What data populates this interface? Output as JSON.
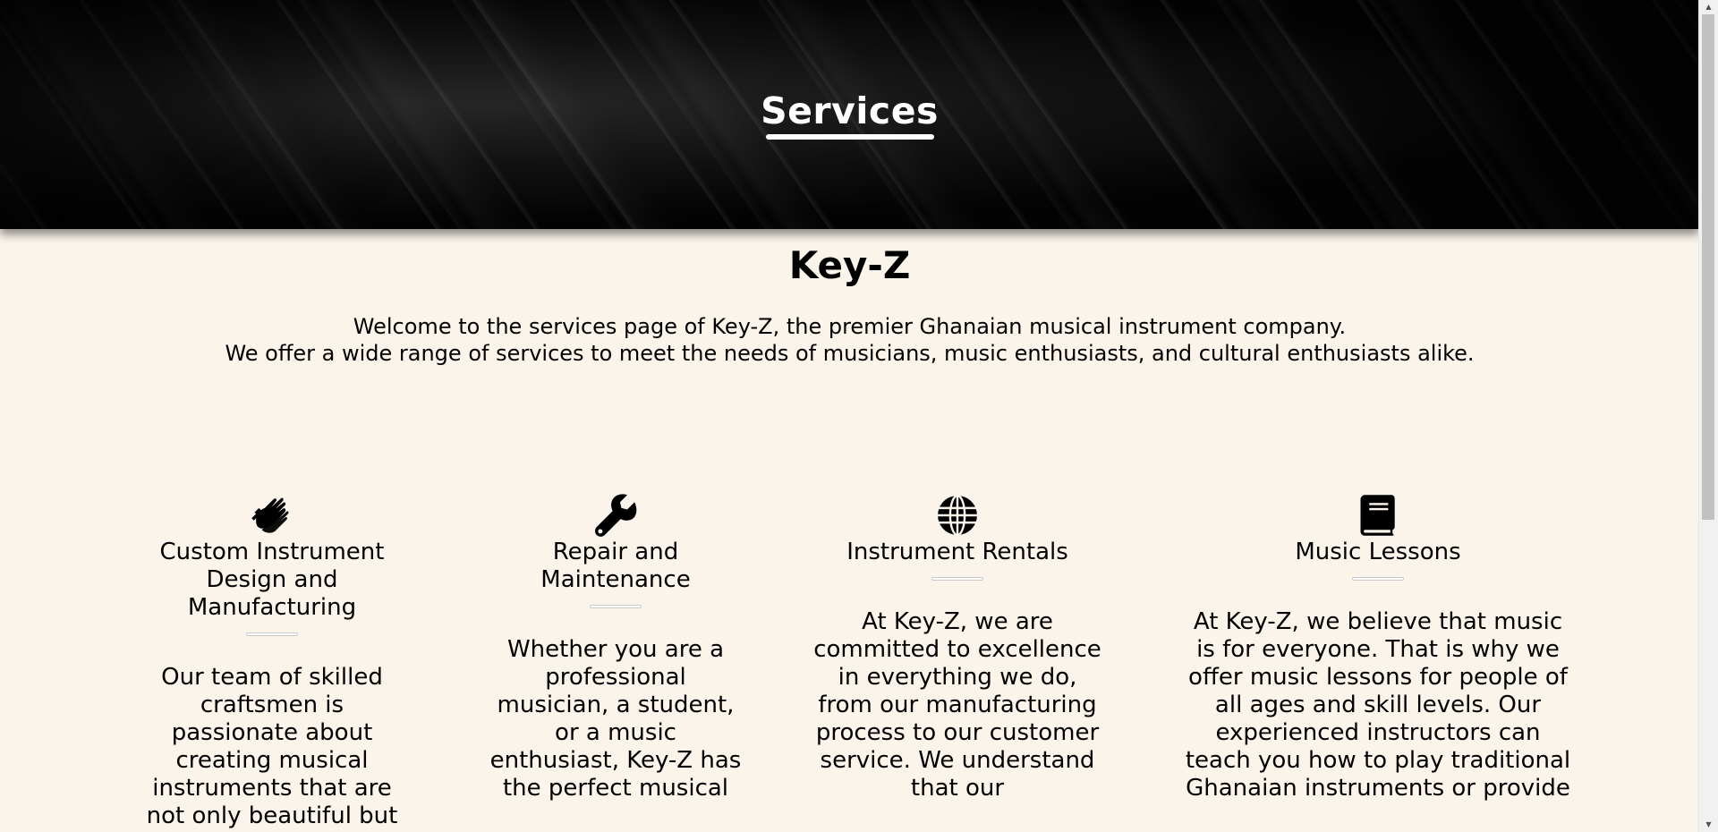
{
  "hero": {
    "title": "Services"
  },
  "brand": "Key-Z",
  "intro": {
    "line1": "Welcome to the services page of Key-Z, the premier Ghanaian musical instrument company.",
    "line2": "We offer a wide range of services to meet the needs of musicians, music enthusiasts, and cultural enthusiasts alike."
  },
  "services": [
    {
      "icon": "hands-icon",
      "title": "Custom Instrument Design and Manufacturing",
      "body": "Our team of skilled craftsmen is passionate about creating musical instruments that are not only beautiful but"
    },
    {
      "icon": "wrench-icon",
      "title": "Repair and Maintenance",
      "body": "Whether you are a professional musician, a student, or a music enthusiast, Key-Z has the perfect musical"
    },
    {
      "icon": "globe-icon",
      "title": "Instrument Rentals",
      "body": "At Key-Z, we are committed to excellence in everything we do, from our manufacturing process to our customer service. We understand that our"
    },
    {
      "icon": "book-icon",
      "title": "Music Lessons",
      "body": "At Key-Z, we believe that music is for everyone. That is why we offer music lessons for people of all ages and skill levels. Our experienced instructors can teach you how to play traditional Ghanaian instruments or provide"
    }
  ]
}
